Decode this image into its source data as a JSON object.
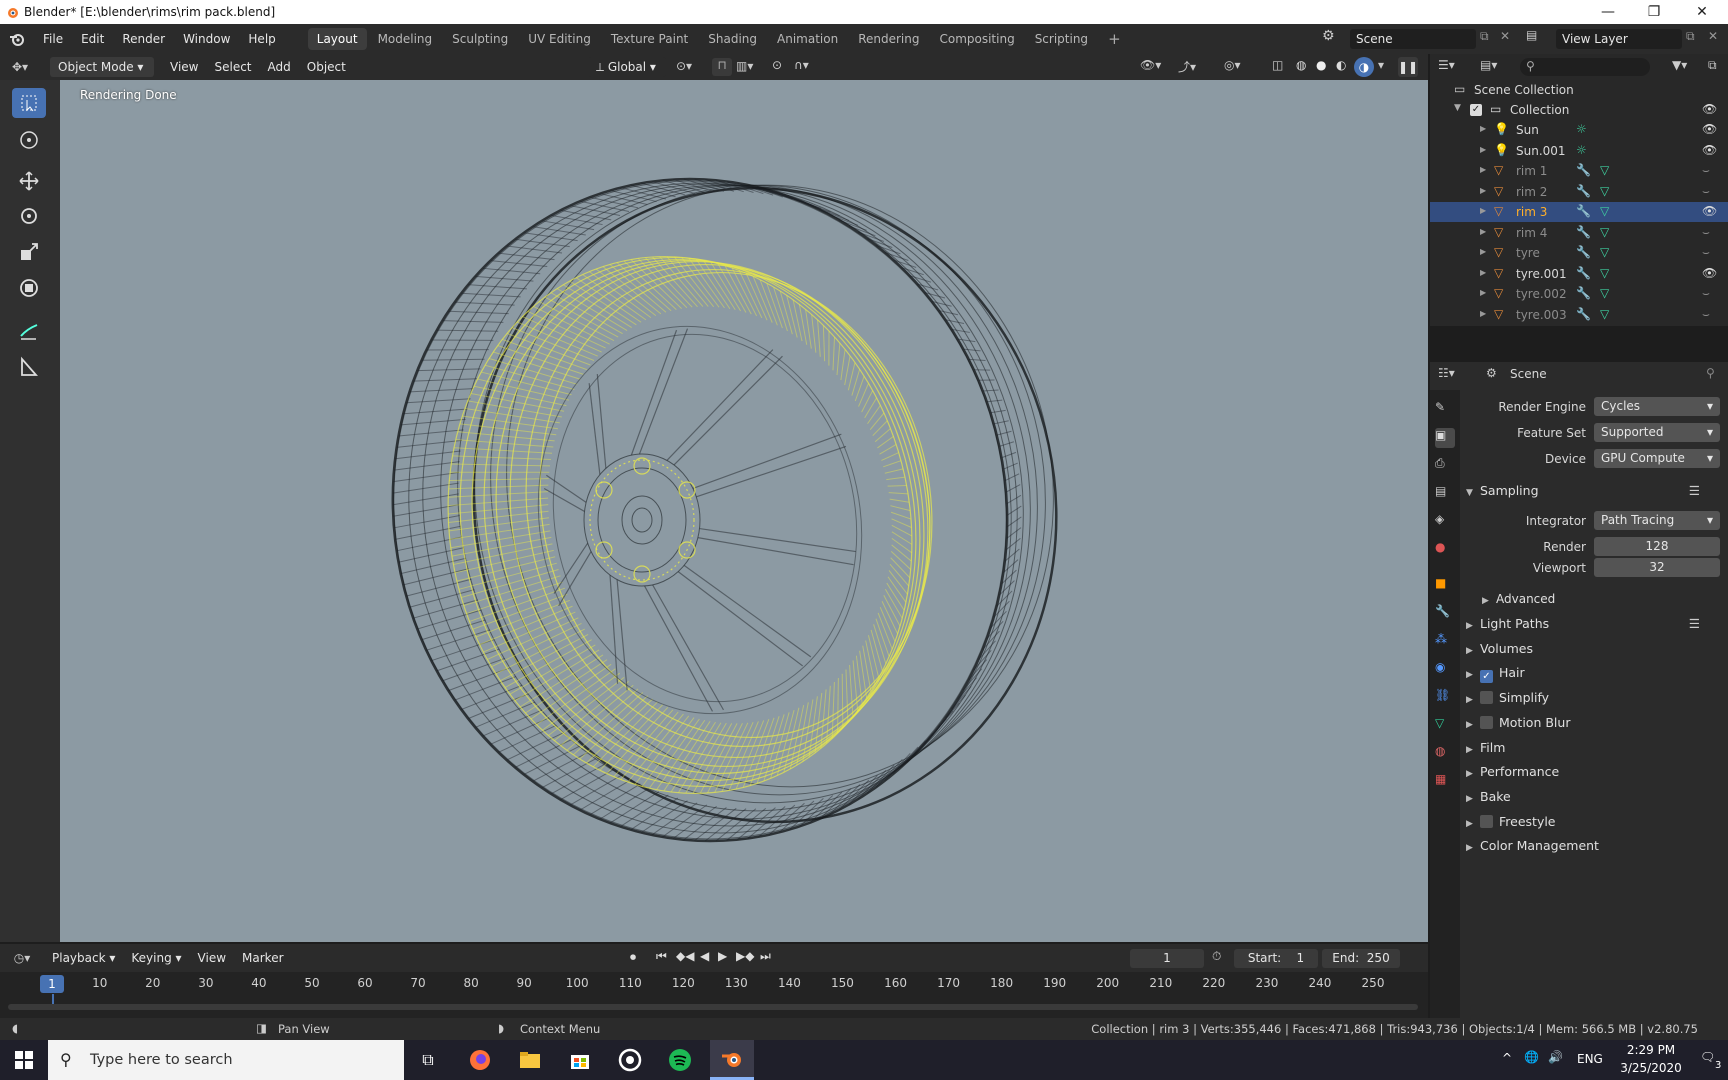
{
  "window": {
    "title": "Blender* [E:\\blender\\rims\\rim pack.blend]",
    "controls": [
      "—",
      "❐",
      "✕"
    ]
  },
  "menu": [
    "File",
    "Edit",
    "Render",
    "Window",
    "Help"
  ],
  "workspaces": [
    "Layout",
    "Modeling",
    "Sculpting",
    "UV Editing",
    "Texture Paint",
    "Shading",
    "Animation",
    "Rendering",
    "Compositing",
    "Scripting"
  ],
  "active_workspace": "Layout",
  "scene_field": "Scene",
  "view_layer_field": "View Layer",
  "viewport_header": {
    "mode": "Object Mode",
    "menus": [
      "View",
      "Select",
      "Add",
      "Object"
    ],
    "orientation": "Global"
  },
  "viewport": {
    "status": "Rendering Done"
  },
  "outliner": {
    "root": "Scene Collection",
    "collection": "Collection",
    "items": [
      {
        "name": "Sun",
        "type": "light",
        "visible": true,
        "dim": false,
        "hl": false
      },
      {
        "name": "Sun.001",
        "type": "light",
        "visible": true,
        "dim": false,
        "hl": false
      },
      {
        "name": "rim 1",
        "type": "mesh",
        "visible": false,
        "dim": true,
        "hl": false
      },
      {
        "name": "rim 2",
        "type": "mesh",
        "visible": false,
        "dim": true,
        "hl": false
      },
      {
        "name": "rim 3",
        "type": "mesh",
        "visible": true,
        "dim": false,
        "hl": true
      },
      {
        "name": "rim 4",
        "type": "mesh",
        "visible": false,
        "dim": true,
        "hl": false
      },
      {
        "name": "tyre",
        "type": "mesh",
        "visible": false,
        "dim": true,
        "hl": false
      },
      {
        "name": "tyre.001",
        "type": "mesh",
        "visible": true,
        "dim": false,
        "hl": false
      },
      {
        "name": "tyre.002",
        "type": "mesh",
        "visible": false,
        "dim": true,
        "hl": false
      },
      {
        "name": "tyre.003",
        "type": "mesh",
        "visible": false,
        "dim": true,
        "hl": false
      }
    ]
  },
  "properties": {
    "context": "Scene",
    "render_engine_label": "Render Engine",
    "render_engine": "Cycles",
    "feature_set_label": "Feature Set",
    "feature_set": "Supported",
    "device_label": "Device",
    "device": "GPU Compute",
    "sampling": "Sampling",
    "integrator_label": "Integrator",
    "integrator": "Path Tracing",
    "render_label": "Render",
    "render_samples": "128",
    "viewport_label": "Viewport",
    "viewport_samples": "32",
    "advanced": "Advanced",
    "panels": [
      {
        "label": "Light Paths",
        "checkbox": null
      },
      {
        "label": "Volumes",
        "checkbox": null
      },
      {
        "label": "Hair",
        "checkbox": true
      },
      {
        "label": "Simplify",
        "checkbox": false
      },
      {
        "label": "Motion Blur",
        "checkbox": false
      },
      {
        "label": "Film",
        "checkbox": null
      },
      {
        "label": "Performance",
        "checkbox": null
      },
      {
        "label": "Bake",
        "checkbox": null
      },
      {
        "label": "Freestyle",
        "checkbox": false
      },
      {
        "label": "Color Management",
        "checkbox": null
      }
    ]
  },
  "timeline": {
    "menus": [
      "Playback",
      "Keying",
      "View",
      "Marker"
    ],
    "current_frame": "1",
    "start_label": "Start:",
    "start": "1",
    "end_label": "End:",
    "end": "250",
    "ticks": [
      "1",
      "10",
      "20",
      "30",
      "40",
      "50",
      "60",
      "70",
      "80",
      "90",
      "100",
      "110",
      "120",
      "130",
      "140",
      "150",
      "160",
      "170",
      "180",
      "190",
      "200",
      "210",
      "220",
      "230",
      "240",
      "250"
    ]
  },
  "statusbar": {
    "pan": "Pan View",
    "context": "Context Menu",
    "stats": "Collection | rim 3 | Verts:355,446 | Faces:471,868 | Tris:943,736 | Objects:1/4 | Mem: 566.5 MB | v2.80.75"
  },
  "taskbar": {
    "search_placeholder": "Type here to search",
    "lang": "ENG",
    "time": "2:29 PM",
    "date": "3/25/2020",
    "notif_count": "3"
  },
  "colors": {
    "accent": "#4772b3",
    "highlight": "#ffaf29",
    "viewport_bg": "#8c9aa3",
    "wire_selected": "#e0e04a"
  }
}
